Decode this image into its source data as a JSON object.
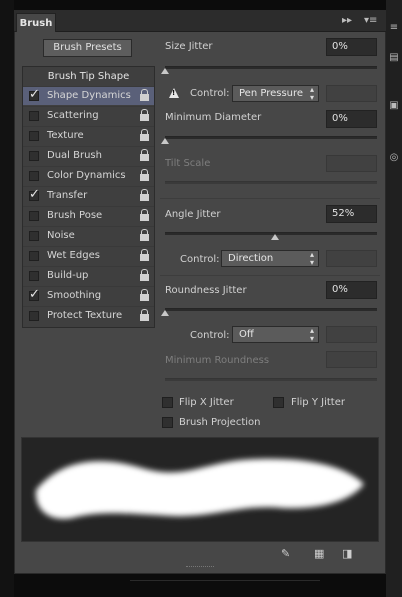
{
  "panel": {
    "tab_title": "Brush",
    "collapse_glyph": "▸▸",
    "menu_glyph": "▾≡",
    "brush_presets_button": "Brush Presets"
  },
  "brush_list": {
    "heading": "Brush Tip Shape",
    "items": [
      {
        "label": "Shape Dynamics",
        "checked": true,
        "selected": true
      },
      {
        "label": "Scattering",
        "checked": false,
        "selected": false
      },
      {
        "label": "Texture",
        "checked": false,
        "selected": false
      },
      {
        "label": "Dual Brush",
        "checked": false,
        "selected": false
      },
      {
        "label": "Color Dynamics",
        "checked": false,
        "selected": false
      },
      {
        "label": "Transfer",
        "checked": true,
        "selected": false
      },
      {
        "label": "Brush Pose",
        "checked": false,
        "selected": false
      },
      {
        "label": "Noise",
        "checked": false,
        "selected": false
      },
      {
        "label": "Wet Edges",
        "checked": false,
        "selected": false
      },
      {
        "label": "Build-up",
        "checked": false,
        "selected": false
      },
      {
        "label": "Smoothing",
        "checked": true,
        "selected": false
      },
      {
        "label": "Protect Texture",
        "checked": false,
        "selected": false
      }
    ]
  },
  "shape_dynamics": {
    "size_jitter": {
      "label": "Size Jitter",
      "value": "0%",
      "level": 0
    },
    "size_control": {
      "label": "Control:",
      "value": "Pen Pressure"
    },
    "minimum_diameter": {
      "label": "Minimum Diameter",
      "value": "0%",
      "level": 0
    },
    "tilt_scale": {
      "label": "Tilt Scale"
    },
    "angle_jitter": {
      "label": "Angle Jitter",
      "value": "52%",
      "level": 0.52
    },
    "angle_control": {
      "label": "Control:",
      "value": "Direction"
    },
    "roundness_jitter": {
      "label": "Roundness Jitter",
      "value": "0%",
      "level": 0
    },
    "roundness_control": {
      "label": "Control:",
      "value": "Off"
    },
    "minimum_roundness": {
      "label": "Minimum Roundness"
    },
    "flip_x": {
      "label": "Flip X Jitter",
      "checked": false
    },
    "flip_y": {
      "label": "Flip Y Jitter",
      "checked": false
    },
    "brush_projection": {
      "label": "Brush Projection",
      "checked": false
    }
  },
  "icons": {
    "warning": "warning-icon",
    "lock": "lock-icon",
    "toggle_live_tip": "brush-preview-toggle-icon",
    "create_preset": "grid-icon",
    "new_brush": "new-document-icon"
  }
}
